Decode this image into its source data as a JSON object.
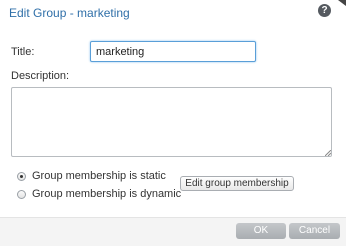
{
  "dialog": {
    "title": "Edit Group - marketing",
    "help_icon": "?"
  },
  "form": {
    "title_label": "Title:",
    "title_value": "marketing",
    "description_label": "Description:",
    "description_value": ""
  },
  "membership": {
    "options": [
      {
        "label": "Group membership is static",
        "selected": true
      },
      {
        "label": "Group membership is dynamic",
        "selected": false
      }
    ],
    "edit_button_label": "Edit group membership"
  },
  "footer": {
    "ok_label": "OK",
    "cancel_label": "Cancel"
  }
}
